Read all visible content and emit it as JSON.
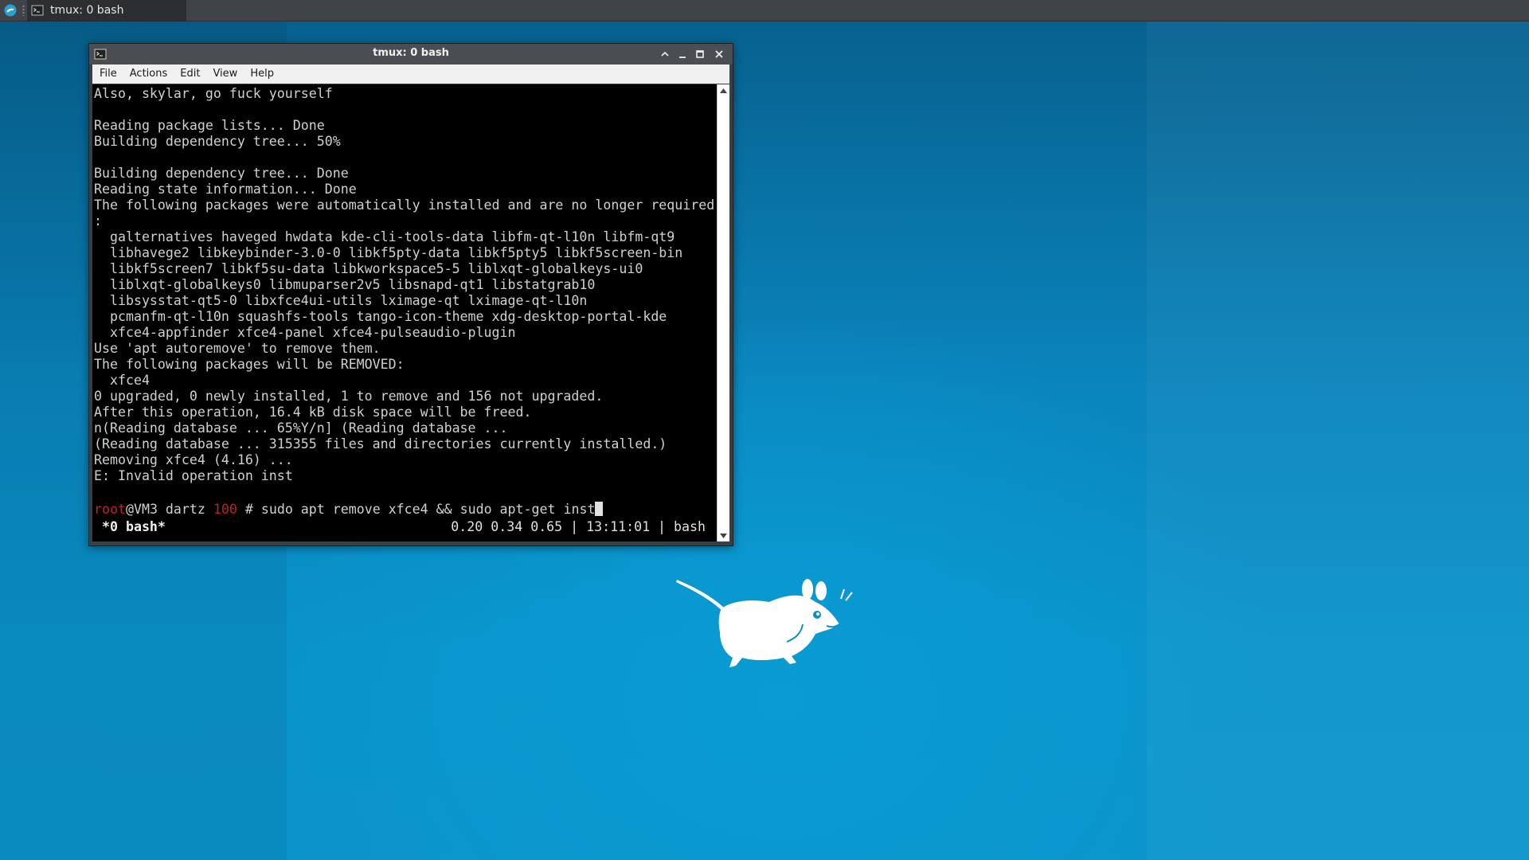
{
  "panel": {
    "whisker_icon": "xfce-menu-icon",
    "task_title": "tmux: 0 bash",
    "task_icon": "terminal-icon"
  },
  "window": {
    "title": "tmux: 0 bash",
    "icon": "terminal-icon",
    "controls": [
      "shade-icon",
      "minimize-icon",
      "maximize-icon",
      "close-icon"
    ]
  },
  "menubar": {
    "items": [
      "File",
      "Actions",
      "Edit",
      "View",
      "Help"
    ]
  },
  "terminal": {
    "lines": [
      "Also, skylar, go fuck yourself",
      "",
      "Reading package lists... Done",
      "Building dependency tree... 50%",
      "",
      "Building dependency tree... Done",
      "Reading state information... Done",
      "The following packages were automatically installed and are no longer required",
      ":",
      "  galternatives haveged hwdata kde-cli-tools-data libfm-qt-l10n libfm-qt9",
      "  libhavege2 libkeybinder-3.0-0 libkf5pty-data libkf5pty5 libkf5screen-bin",
      "  libkf5screen7 libkf5su-data libkworkspace5-5 liblxqt-globalkeys-ui0",
      "  liblxqt-globalkeys0 libmuparser2v5 libsnapd-qt1 libstatgrab10",
      "  libsysstat-qt5-0 libxfce4ui-utils lximage-qt lximage-qt-l10n",
      "  pcmanfm-qt-l10n squashfs-tools tango-icon-theme xdg-desktop-portal-kde",
      "  xfce4-appfinder xfce4-panel xfce4-pulseaudio-plugin",
      "Use 'apt autoremove' to remove them.",
      "The following packages will be REMOVED:",
      "  xfce4",
      "0 upgraded, 0 newly installed, 1 to remove and 156 not upgraded.",
      "After this operation, 16.4 kB disk space will be freed.",
      "n(Reading database ... 65%Y/n] (Reading database ...",
      "(Reading database ... 315355 files and directories currently installed.)",
      "Removing xfce4 (4.16) ...",
      "E: Invalid operation inst",
      ""
    ],
    "prompt": {
      "user": "root",
      "host": "@VM3 dartz ",
      "code": "100",
      "symbol": " # ",
      "command": "sudo apt remove xfce4 && sudo apt-get inst"
    },
    "status": {
      "left": " *0 bash*",
      "right": "0.20 0.34 0.65 | 13:11:01 | bash"
    }
  },
  "desktop": {
    "mascot_icon": "xfce-mouse-logo",
    "colors": {
      "background": "#0a8fc7",
      "panel": "#404347",
      "prompt_red": "#c02020"
    }
  }
}
